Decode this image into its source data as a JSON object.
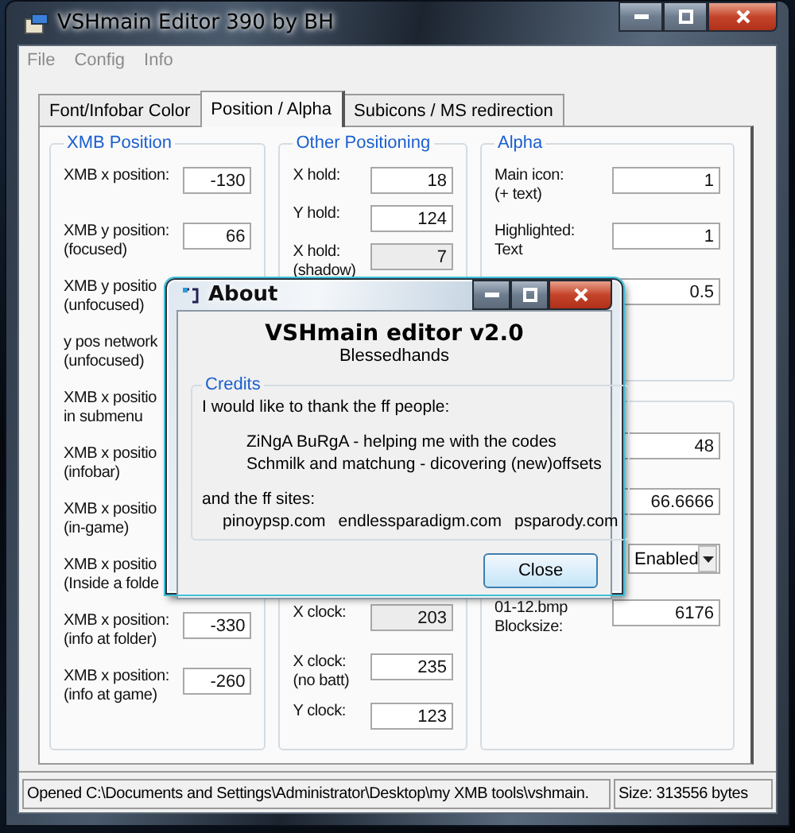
{
  "window": {
    "title": "VSHmain Editor 390 by BH"
  },
  "menu": [
    "File",
    "Config",
    "Info"
  ],
  "tabs": [
    {
      "label": "Font/Infobar Color",
      "selected": false
    },
    {
      "label": "Position / Alpha",
      "selected": true
    },
    {
      "label": "Subicons / MS redirection",
      "selected": false
    }
  ],
  "xmb_position": {
    "title": "XMB Position",
    "rows": [
      {
        "label": "XMB x position:",
        "value": "-130"
      },
      {
        "label": "XMB y position:\n(focused)",
        "value": "66"
      },
      {
        "label": "XMB y positio\n(unfocused)"
      },
      {
        "label": "y pos network\n(unfocused)"
      },
      {
        "label": "XMB x positio\nin submenu"
      },
      {
        "label": "XMB x positio\n(infobar)"
      },
      {
        "label": "XMB x positio\n(in-game)"
      },
      {
        "label": "XMB x positio\n(Inside a folde"
      },
      {
        "label": "XMB x position:\n(info at folder)",
        "value": "-330"
      },
      {
        "label": "XMB x position:\n(info at game)",
        "value": "-260"
      }
    ]
  },
  "other_positioning": {
    "title": "Other Positioning",
    "top_rows": [
      {
        "label": "X hold:",
        "value": "18"
      },
      {
        "label": "Y hold:",
        "value": "124"
      },
      {
        "label": "X hold:\n(shadow)",
        "value": "7"
      }
    ],
    "bottom_rows": [
      {
        "label": "X clock:",
        "value": "203"
      },
      {
        "label": "X clock:\n(no batt)",
        "value": "235"
      },
      {
        "label": "Y clock:",
        "value": "123"
      }
    ]
  },
  "alpha": {
    "title": "Alpha",
    "rows": [
      {
        "label": "Main icon:\n(+ text)",
        "value": "1"
      },
      {
        "label": "Highlighted:\nText",
        "value": "1"
      },
      {
        "value": "0.5"
      }
    ]
  },
  "other_settings": {
    "rows": [
      {
        "kind": "field",
        "value": "48"
      },
      {
        "kind": "field",
        "value": "66.6666"
      },
      {
        "kind": "dropdown",
        "value": "Enabled"
      },
      {
        "kind": "field",
        "label": "01-12.bmp\nBlocksize:",
        "value": "6176"
      }
    ]
  },
  "status_bar": {
    "path": "Opened C:\\Documents and Settings\\Administrator\\Desktop\\my XMB tools\\vshmain.",
    "size": "Size:  313556 bytes"
  },
  "about_dialog": {
    "title": "About",
    "heading": "VSHmain editor v2.0",
    "author": "Blessedhands",
    "credits_title": "Credits",
    "intro": "I would like to thank the ff people:",
    "people": [
      "ZiNgA BuRgA - helping me with the codes",
      "Schmilk and matchung - dicovering (new)offsets"
    ],
    "sites_intro": "and the ff sites:",
    "sites": [
      "pinoypsp.com",
      "endlessparadigm.com",
      "psparody.com"
    ],
    "button": "Close"
  }
}
